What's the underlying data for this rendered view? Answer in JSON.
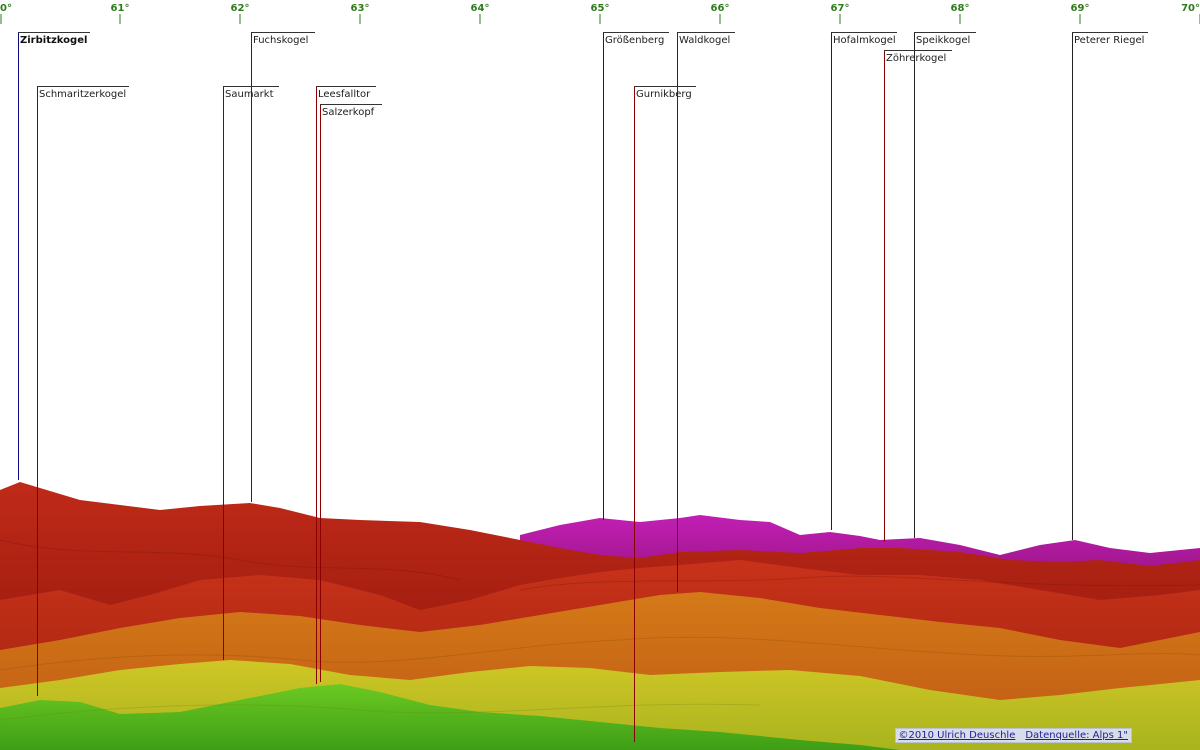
{
  "axis": {
    "ticks": [
      "0°",
      "61°",
      "62°",
      "63°",
      "64°",
      "65°",
      "66°",
      "67°",
      "68°",
      "69°",
      "70°"
    ],
    "tick_color": "#2f7a1c"
  },
  "peaks": [
    {
      "label": "Zirbitzkogel",
      "main": true,
      "line_color": "#0a0a80"
    },
    {
      "label": "Schmaritzerkogel",
      "main": false,
      "line_color": "#8b0000"
    },
    {
      "label": "Fuchskogel",
      "main": false,
      "line_color": "#8b0000"
    },
    {
      "label": "Saumarkt",
      "main": false,
      "line_color": "#8b0000"
    },
    {
      "label": "Leesfalltor",
      "main": false,
      "line_color": "#8b0000"
    },
    {
      "label": "Salzerkopf",
      "main": false,
      "line_color": "#8b0000"
    },
    {
      "label": "Größenberg",
      "main": false,
      "line_color": "#222222"
    },
    {
      "label": "Waldkogel",
      "main": false,
      "line_color": "#8b0000"
    },
    {
      "label": "Gurnikberg",
      "main": false,
      "line_color": "#8b0000"
    },
    {
      "label": "Hofalmkogel",
      "main": false,
      "line_color": "#222222"
    },
    {
      "label": "Speikkogel",
      "main": false,
      "line_color": "#222222"
    },
    {
      "label": "Zöhrerkogel",
      "main": false,
      "line_color": "#8b0000"
    },
    {
      "label": "Peterer Riegel",
      "main": false,
      "line_color": "#222222"
    }
  ],
  "credits": {
    "copyright": "©2010 Ulrich Deuschle",
    "source": "Datenquelle: Alps 1\""
  },
  "colors": {
    "far_ridge": "#b01aa0",
    "red_ridge": "#b82014",
    "dark_red": "#8e1a10",
    "orange": "#d26a14",
    "yellow": "#c8bf1e",
    "green": "#5fbe1e"
  }
}
